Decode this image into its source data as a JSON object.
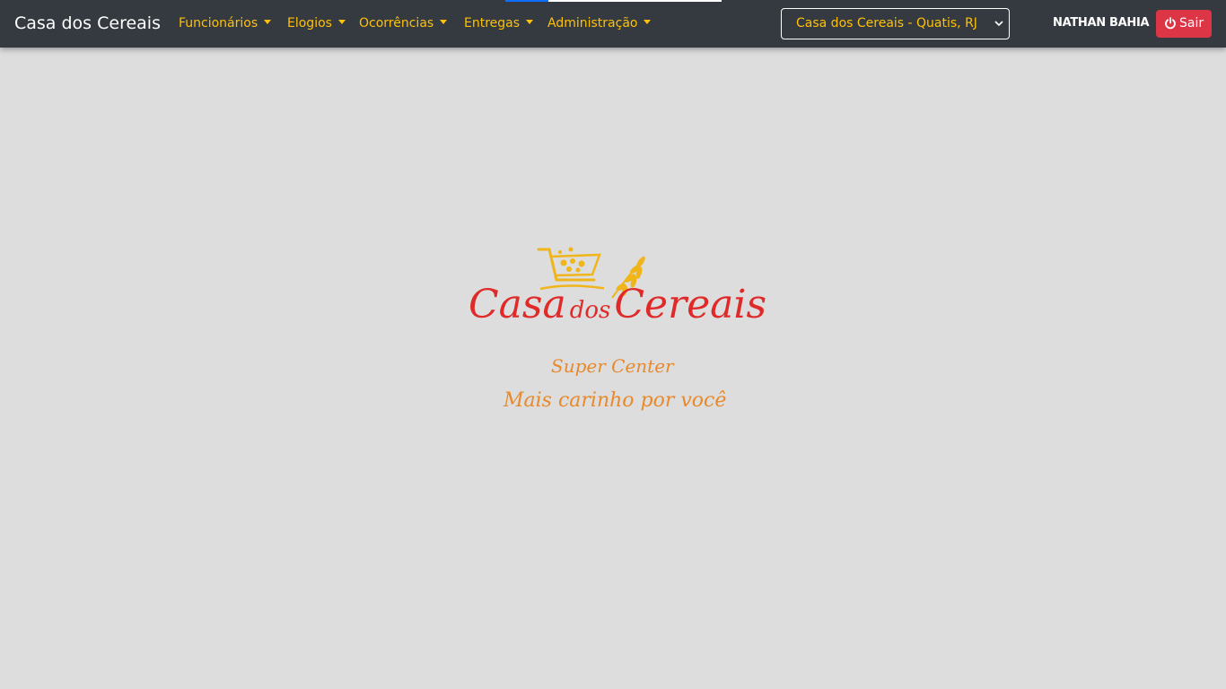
{
  "navbar": {
    "brand": "Casa dos Cereais",
    "menu": [
      {
        "label": "Funcionários"
      },
      {
        "label": "Elogios"
      },
      {
        "label": "Ocorrências"
      },
      {
        "label": "Entregas"
      },
      {
        "label": "Administração"
      }
    ],
    "store_select": {
      "selected": "Casa dos Cereais - Quatis, RJ"
    },
    "user": "NATHAN BAHIA",
    "logout_label": "Sair",
    "loading_progress": 0.2
  },
  "logo": {
    "title_part1": "Casa",
    "title_part2": "dos",
    "title_part3": "Cereais",
    "subtitle": "Super Center",
    "tagline": "Mais carinho por você",
    "icons": [
      "shopping-cart-icon",
      "wheat-icon"
    ]
  },
  "colors": {
    "navbar_bg": "#343a40",
    "accent": "#ffc107",
    "danger": "#dc3545",
    "page_bg": "#dddddd",
    "logo_red": "#e02a2a",
    "logo_orange": "#e8892c"
  }
}
